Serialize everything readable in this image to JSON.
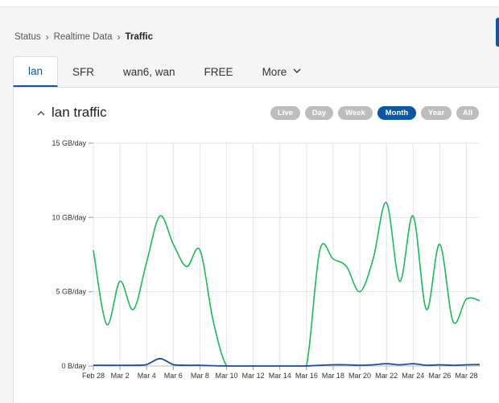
{
  "breadcrumb": {
    "items": [
      "Status",
      "Realtime Data",
      "Traffic"
    ]
  },
  "tabs": [
    {
      "label": "lan",
      "active": true
    },
    {
      "label": "SFR",
      "active": false
    },
    {
      "label": "wan6, wan",
      "active": false
    },
    {
      "label": "FREE",
      "active": false
    },
    {
      "label": "More",
      "active": false
    }
  ],
  "section": {
    "title": "lan traffic"
  },
  "periods": [
    {
      "label": "Live",
      "active": false
    },
    {
      "label": "Day",
      "active": false
    },
    {
      "label": "Week",
      "active": false
    },
    {
      "label": "Month",
      "active": true
    },
    {
      "label": "Year",
      "active": false
    },
    {
      "label": "All",
      "active": false
    }
  ],
  "colors": {
    "accent": "#0b57a4",
    "pill_inactive": "#bdbdbd",
    "series_green": "#1db954",
    "series_blue": "#1f4e9c"
  },
  "chart_data": {
    "type": "line",
    "title": "",
    "xlabel": "",
    "ylabel": "",
    "y_unit": "GB/day",
    "ylim": [
      0,
      15
    ],
    "y_ticks": [
      {
        "value": 0,
        "label": "0 B/day"
      },
      {
        "value": 5,
        "label": "5 GB/day"
      },
      {
        "value": 10,
        "label": "10 GB/day"
      },
      {
        "value": 15,
        "label": "15 GB/day"
      }
    ],
    "x": [
      "Feb 28",
      "Mar 1",
      "Mar 2",
      "Mar 3",
      "Mar 4",
      "Mar 5",
      "Mar 6",
      "Mar 7",
      "Mar 8",
      "Mar 9",
      "Mar 10",
      "Mar 11",
      "Mar 12",
      "Mar 13",
      "Mar 14",
      "Mar 15",
      "Mar 16",
      "Mar 17",
      "Mar 18",
      "Mar 19",
      "Mar 20",
      "Mar 21",
      "Mar 22",
      "Mar 23",
      "Mar 24",
      "Mar 25",
      "Mar 26",
      "Mar 27",
      "Mar 28",
      "Mar 29"
    ],
    "x_tick_labels": [
      "Feb 28",
      "Mar 2",
      "Mar 4",
      "Mar 6",
      "Mar 8",
      "Mar 10",
      "Mar 12",
      "Mar 14",
      "Mar 16",
      "Mar 18",
      "Mar 20",
      "Mar 22",
      "Mar 24",
      "Mar 26",
      "Mar 28"
    ],
    "grid": true,
    "series": [
      {
        "color": "#1db954",
        "values": [
          7.8,
          2.8,
          5.7,
          3.8,
          7.0,
          10.1,
          8.2,
          6.7,
          7.8,
          3.0,
          0,
          0,
          0,
          0,
          0,
          0,
          0,
          7.8,
          7.2,
          6.7,
          5.0,
          7.2,
          11.0,
          5.7,
          10.1,
          3.8,
          8.2,
          3.0,
          4.5,
          4.4
        ]
      },
      {
        "color": "#1f4e9c",
        "values": [
          0.05,
          0.05,
          0.05,
          0.05,
          0.1,
          0.5,
          0.1,
          0.05,
          0.05,
          0.02,
          0,
          0,
          0,
          0,
          0,
          0,
          0,
          0.05,
          0.08,
          0.08,
          0.05,
          0.08,
          0.15,
          0.08,
          0.15,
          0.05,
          0.08,
          0.05,
          0.08,
          0.1
        ]
      }
    ]
  }
}
